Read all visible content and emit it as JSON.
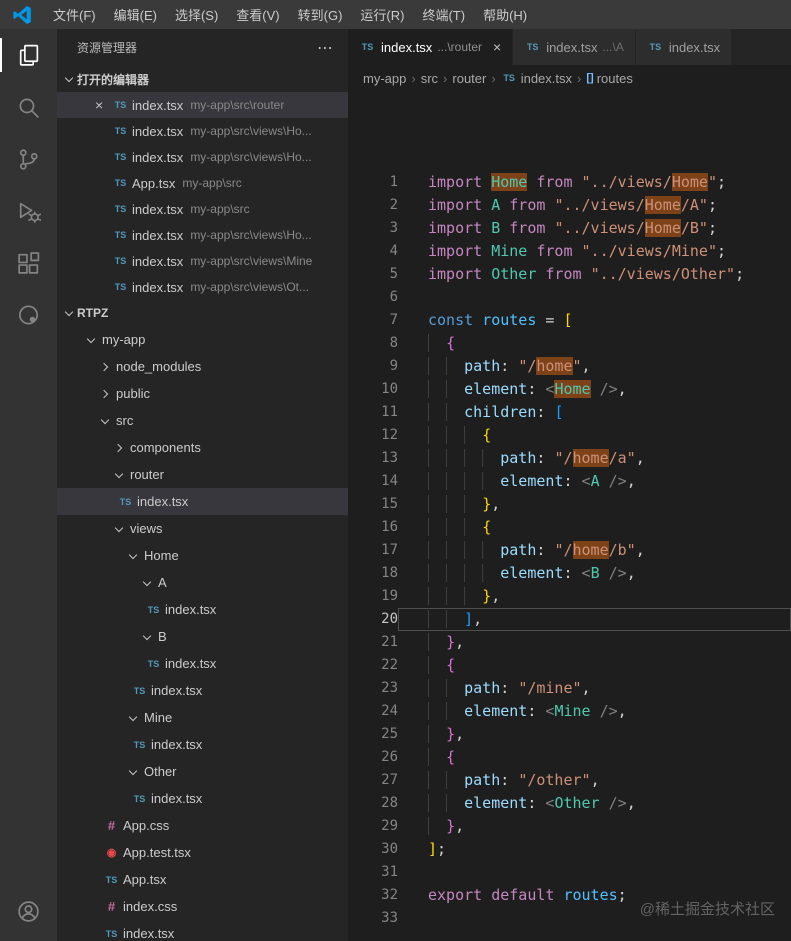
{
  "colors": {
    "titlebar_bg": "#3a3a3b",
    "activitybar_bg": "#333333",
    "sidebar_bg": "#252526",
    "editor_bg": "#1e1e1e",
    "selection_bg": "#37373d",
    "word_highlight_bg": "#7e4219",
    "ts_icon": "#519aba",
    "css_icon": "#c76b9c",
    "test_icon": "#e5484d",
    "logo_blue": "#0098e5"
  },
  "menubar": {
    "items": [
      "文件(F)",
      "编辑(E)",
      "选择(S)",
      "查看(V)",
      "转到(G)",
      "运行(R)",
      "终端(T)",
      "帮助(H)"
    ]
  },
  "activity_bar": {
    "top": [
      {
        "icon": "files",
        "name": "explorer-icon",
        "active": true
      },
      {
        "icon": "search",
        "name": "search-icon"
      },
      {
        "icon": "source-control",
        "name": "source-control-icon"
      },
      {
        "icon": "debug",
        "name": "run-debug-icon"
      },
      {
        "icon": "extensions",
        "name": "extensions-icon"
      },
      {
        "icon": "circle",
        "name": "circle-icon"
      }
    ],
    "bottom": [
      {
        "icon": "account",
        "name": "account-icon"
      }
    ]
  },
  "sidebar": {
    "title": "资源管理器",
    "open_editors": {
      "label": "打开的编辑器",
      "items": [
        {
          "file": "index.tsx",
          "path": "my-app\\src\\router",
          "icon": "ts",
          "active": true,
          "close": "×"
        },
        {
          "file": "index.tsx",
          "path": "my-app\\src\\views\\Ho...",
          "icon": "ts"
        },
        {
          "file": "index.tsx",
          "path": "my-app\\src\\views\\Ho...",
          "icon": "ts"
        },
        {
          "file": "App.tsx",
          "path": "my-app\\src",
          "icon": "ts"
        },
        {
          "file": "index.tsx",
          "path": "my-app\\src",
          "icon": "ts"
        },
        {
          "file": "index.tsx",
          "path": "my-app\\src\\views\\Ho...",
          "icon": "ts"
        },
        {
          "file": "index.tsx",
          "path": "my-app\\src\\views\\Mine",
          "icon": "ts"
        },
        {
          "file": "index.tsx",
          "path": "my-app\\src\\views\\Ot...",
          "icon": "ts"
        }
      ]
    },
    "workspace": {
      "label": "RTPZ",
      "tree": [
        {
          "label": "my-app",
          "type": "folder",
          "state": "open",
          "depth": 0
        },
        {
          "label": "node_modules",
          "type": "folder",
          "state": "closed",
          "depth": 1
        },
        {
          "label": "public",
          "type": "folder",
          "state": "closed",
          "depth": 1
        },
        {
          "label": "src",
          "type": "folder",
          "state": "open",
          "depth": 1
        },
        {
          "label": "components",
          "type": "folder",
          "state": "closed",
          "depth": 2
        },
        {
          "label": "router",
          "type": "folder",
          "state": "open",
          "depth": 2
        },
        {
          "label": "index.tsx",
          "type": "file",
          "icon": "ts",
          "depth": 3,
          "selected": true
        },
        {
          "label": "views",
          "type": "folder",
          "state": "open",
          "depth": 2
        },
        {
          "label": "Home",
          "type": "folder",
          "state": "open",
          "depth": 3
        },
        {
          "label": "A",
          "type": "folder",
          "state": "open",
          "depth": 4
        },
        {
          "label": "index.tsx",
          "type": "file",
          "icon": "ts",
          "depth": 5
        },
        {
          "label": "B",
          "type": "folder",
          "state": "open",
          "depth": 4
        },
        {
          "label": "index.tsx",
          "type": "file",
          "icon": "ts",
          "depth": 5
        },
        {
          "label": "index.tsx",
          "type": "file",
          "icon": "ts",
          "depth": 4
        },
        {
          "label": "Mine",
          "type": "folder",
          "state": "open",
          "depth": 3
        },
        {
          "label": "index.tsx",
          "type": "file",
          "icon": "ts",
          "depth": 4
        },
        {
          "label": "Other",
          "type": "folder",
          "state": "open",
          "depth": 3
        },
        {
          "label": "index.tsx",
          "type": "file",
          "icon": "ts",
          "depth": 4
        },
        {
          "label": "App.css",
          "type": "file",
          "icon": "css",
          "depth": 2
        },
        {
          "label": "App.test.tsx",
          "type": "file",
          "icon": "test",
          "depth": 2
        },
        {
          "label": "App.tsx",
          "type": "file",
          "icon": "ts",
          "depth": 2
        },
        {
          "label": "index.css",
          "type": "file",
          "icon": "css",
          "depth": 2
        },
        {
          "label": "index.tsx",
          "type": "file",
          "icon": "ts",
          "depth": 2
        }
      ]
    }
  },
  "editor": {
    "tabs": [
      {
        "file": "index.tsx",
        "desc": "...\\router",
        "icon": "ts",
        "active": true,
        "close": "×"
      },
      {
        "file": "index.tsx",
        "desc": "...\\A",
        "icon": "ts"
      },
      {
        "file": "index.tsx",
        "desc": "",
        "icon": "ts"
      }
    ],
    "breadcrumbs": [
      {
        "label": "my-app"
      },
      {
        "label": "src"
      },
      {
        "label": "router"
      },
      {
        "label": "index.tsx",
        "icon": "ts"
      },
      {
        "label": "routes",
        "icon": "symbol"
      }
    ],
    "code": {
      "language": "typescriptreact",
      "active_line": 20,
      "lines": [
        [
          {
            "t": "import ",
            "c": "kw"
          },
          {
            "t": "Home",
            "c": "cmp",
            "h": true
          },
          {
            "t": " ",
            "c": "pun"
          },
          {
            "t": "from",
            "c": "kw"
          },
          {
            "t": " ",
            "c": "pun"
          },
          {
            "t": "\"../views/",
            "c": "str"
          },
          {
            "t": "Home",
            "c": "str",
            "h": true
          },
          {
            "t": "\"",
            "c": "str"
          },
          {
            "t": ";",
            "c": "pun"
          }
        ],
        [
          {
            "t": "import ",
            "c": "kw"
          },
          {
            "t": "A",
            "c": "cmp"
          },
          {
            "t": " ",
            "c": "pun"
          },
          {
            "t": "from",
            "c": "kw"
          },
          {
            "t": " ",
            "c": "pun"
          },
          {
            "t": "\"../views/",
            "c": "str"
          },
          {
            "t": "Home",
            "c": "str",
            "h": true
          },
          {
            "t": "/A\"",
            "c": "str"
          },
          {
            "t": ";",
            "c": "pun"
          }
        ],
        [
          {
            "t": "import ",
            "c": "kw"
          },
          {
            "t": "B",
            "c": "cmp"
          },
          {
            "t": " ",
            "c": "pun"
          },
          {
            "t": "from",
            "c": "kw"
          },
          {
            "t": " ",
            "c": "pun"
          },
          {
            "t": "\"../views/",
            "c": "str"
          },
          {
            "t": "Home",
            "c": "str",
            "h": true
          },
          {
            "t": "/B\"",
            "c": "str"
          },
          {
            "t": ";",
            "c": "pun"
          }
        ],
        [
          {
            "t": "import ",
            "c": "kw"
          },
          {
            "t": "Mine",
            "c": "cmp"
          },
          {
            "t": " ",
            "c": "pun"
          },
          {
            "t": "from",
            "c": "kw"
          },
          {
            "t": " ",
            "c": "pun"
          },
          {
            "t": "\"../views/Mine\"",
            "c": "str"
          },
          {
            "t": ";",
            "c": "pun"
          }
        ],
        [
          {
            "t": "import ",
            "c": "kw"
          },
          {
            "t": "Other",
            "c": "cmp"
          },
          {
            "t": " ",
            "c": "pun"
          },
          {
            "t": "from",
            "c": "kw"
          },
          {
            "t": " ",
            "c": "pun"
          },
          {
            "t": "\"../views/Other\"",
            "c": "str"
          },
          {
            "t": ";",
            "c": "pun"
          }
        ],
        [],
        [
          {
            "t": "const",
            "c": "ckw"
          },
          {
            "t": " ",
            "c": "pun"
          },
          {
            "t": "routes",
            "c": "var"
          },
          {
            "t": " = ",
            "c": "pun"
          },
          {
            "t": "[",
            "c": "b1"
          }
        ],
        [
          {
            "t": "  ",
            "c": "ws"
          },
          {
            "t": "{",
            "c": "b2"
          }
        ],
        [
          {
            "t": "    ",
            "c": "ws"
          },
          {
            "t": "path",
            "c": "prop"
          },
          {
            "t": ": ",
            "c": "pun"
          },
          {
            "t": "\"/",
            "c": "str"
          },
          {
            "t": "home",
            "c": "str",
            "h": true
          },
          {
            "t": "\"",
            "c": "str"
          },
          {
            "t": ",",
            "c": "pun"
          }
        ],
        [
          {
            "t": "    ",
            "c": "ws"
          },
          {
            "t": "element",
            "c": "prop"
          },
          {
            "t": ": ",
            "c": "pun"
          },
          {
            "t": "<",
            "c": "jsx"
          },
          {
            "t": "Home",
            "c": "cmp",
            "h": true
          },
          {
            "t": " ",
            "c": "pun"
          },
          {
            "t": "/>",
            "c": "jsx"
          },
          {
            "t": ",",
            "c": "pun"
          }
        ],
        [
          {
            "t": "    ",
            "c": "ws"
          },
          {
            "t": "children",
            "c": "prop"
          },
          {
            "t": ": ",
            "c": "pun"
          },
          {
            "t": "[",
            "c": "b3"
          }
        ],
        [
          {
            "t": "      ",
            "c": "ws"
          },
          {
            "t": "{",
            "c": "b1"
          }
        ],
        [
          {
            "t": "        ",
            "c": "ws"
          },
          {
            "t": "path",
            "c": "prop"
          },
          {
            "t": ": ",
            "c": "pun"
          },
          {
            "t": "\"/",
            "c": "str"
          },
          {
            "t": "home",
            "c": "str",
            "h": true
          },
          {
            "t": "/a\"",
            "c": "str"
          },
          {
            "t": ",",
            "c": "pun"
          }
        ],
        [
          {
            "t": "        ",
            "c": "ws"
          },
          {
            "t": "element",
            "c": "prop"
          },
          {
            "t": ": ",
            "c": "pun"
          },
          {
            "t": "<",
            "c": "jsx"
          },
          {
            "t": "A",
            "c": "cmp"
          },
          {
            "t": " ",
            "c": "pun"
          },
          {
            "t": "/>",
            "c": "jsx"
          },
          {
            "t": ",",
            "c": "pun"
          }
        ],
        [
          {
            "t": "      ",
            "c": "ws"
          },
          {
            "t": "}",
            "c": "b1"
          },
          {
            "t": ",",
            "c": "pun"
          }
        ],
        [
          {
            "t": "      ",
            "c": "ws"
          },
          {
            "t": "{",
            "c": "b1"
          }
        ],
        [
          {
            "t": "        ",
            "c": "ws"
          },
          {
            "t": "path",
            "c": "prop"
          },
          {
            "t": ": ",
            "c": "pun"
          },
          {
            "t": "\"/",
            "c": "str"
          },
          {
            "t": "home",
            "c": "str",
            "h": true
          },
          {
            "t": "/b\"",
            "c": "str"
          },
          {
            "t": ",",
            "c": "pun"
          }
        ],
        [
          {
            "t": "        ",
            "c": "ws"
          },
          {
            "t": "element",
            "c": "prop"
          },
          {
            "t": ": ",
            "c": "pun"
          },
          {
            "t": "<",
            "c": "jsx"
          },
          {
            "t": "B",
            "c": "cmp"
          },
          {
            "t": " ",
            "c": "pun"
          },
          {
            "t": "/>",
            "c": "jsx"
          },
          {
            "t": ",",
            "c": "pun"
          }
        ],
        [
          {
            "t": "      ",
            "c": "ws"
          },
          {
            "t": "}",
            "c": "b1"
          },
          {
            "t": ",",
            "c": "pun"
          }
        ],
        [
          {
            "t": "    ",
            "c": "ws"
          },
          {
            "t": "]",
            "c": "b3"
          },
          {
            "t": ",",
            "c": "pun"
          }
        ],
        [
          {
            "t": "  ",
            "c": "ws"
          },
          {
            "t": "}",
            "c": "b2"
          },
          {
            "t": ",",
            "c": "pun"
          }
        ],
        [
          {
            "t": "  ",
            "c": "ws"
          },
          {
            "t": "{",
            "c": "b2"
          }
        ],
        [
          {
            "t": "    ",
            "c": "ws"
          },
          {
            "t": "path",
            "c": "prop"
          },
          {
            "t": ": ",
            "c": "pun"
          },
          {
            "t": "\"/mine\"",
            "c": "str"
          },
          {
            "t": ",",
            "c": "pun"
          }
        ],
        [
          {
            "t": "    ",
            "c": "ws"
          },
          {
            "t": "element",
            "c": "prop"
          },
          {
            "t": ": ",
            "c": "pun"
          },
          {
            "t": "<",
            "c": "jsx"
          },
          {
            "t": "Mine",
            "c": "cmp"
          },
          {
            "t": " ",
            "c": "pun"
          },
          {
            "t": "/>",
            "c": "jsx"
          },
          {
            "t": ",",
            "c": "pun"
          }
        ],
        [
          {
            "t": "  ",
            "c": "ws"
          },
          {
            "t": "}",
            "c": "b2"
          },
          {
            "t": ",",
            "c": "pun"
          }
        ],
        [
          {
            "t": "  ",
            "c": "ws"
          },
          {
            "t": "{",
            "c": "b2"
          }
        ],
        [
          {
            "t": "    ",
            "c": "ws"
          },
          {
            "t": "path",
            "c": "prop"
          },
          {
            "t": ": ",
            "c": "pun"
          },
          {
            "t": "\"/other\"",
            "c": "str"
          },
          {
            "t": ",",
            "c": "pun"
          }
        ],
        [
          {
            "t": "    ",
            "c": "ws"
          },
          {
            "t": "element",
            "c": "prop"
          },
          {
            "t": ": ",
            "c": "pun"
          },
          {
            "t": "<",
            "c": "jsx"
          },
          {
            "t": "Other",
            "c": "cmp"
          },
          {
            "t": " ",
            "c": "pun"
          },
          {
            "t": "/>",
            "c": "jsx"
          },
          {
            "t": ",",
            "c": "pun"
          }
        ],
        [
          {
            "t": "  ",
            "c": "ws"
          },
          {
            "t": "}",
            "c": "b2"
          },
          {
            "t": ",",
            "c": "pun"
          }
        ],
        [
          {
            "t": "]",
            "c": "b1"
          },
          {
            "t": ";",
            "c": "pun"
          }
        ],
        [],
        [
          {
            "t": "export",
            "c": "kw"
          },
          {
            "t": " ",
            "c": "pun"
          },
          {
            "t": "default",
            "c": "kw"
          },
          {
            "t": " ",
            "c": "pun"
          },
          {
            "t": "routes",
            "c": "var"
          },
          {
            "t": ";",
            "c": "pun"
          }
        ],
        []
      ]
    }
  },
  "watermark": "@稀土掘金技术社区"
}
